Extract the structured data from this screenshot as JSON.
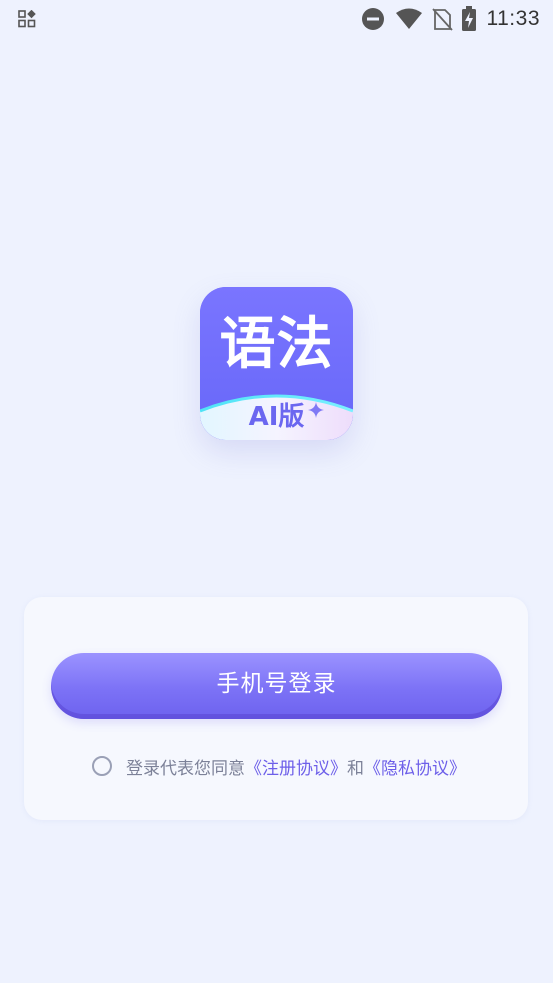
{
  "status_bar": {
    "time": "11:33",
    "icons": [
      "notification-grid-icon",
      "do-not-disturb-icon",
      "wifi-icon",
      "no-sim-icon",
      "battery-charging-icon"
    ]
  },
  "logo": {
    "title": "语法",
    "subtitle": "AI版",
    "sparkle": "✦"
  },
  "login": {
    "phone_button_label": "手机号登录"
  },
  "agreement": {
    "prefix": "登录代表您同意",
    "terms_link": "《注册协议》",
    "connector": "和",
    "privacy_link": "《隐私协议》",
    "checked": false
  },
  "colors": {
    "background": "#EEF2FE",
    "brand": "#6E6BFF",
    "button_top": "#9B93FF",
    "button_bottom": "#6D62EE",
    "link": "#6D5FE9",
    "muted_text": "#7C8198"
  }
}
